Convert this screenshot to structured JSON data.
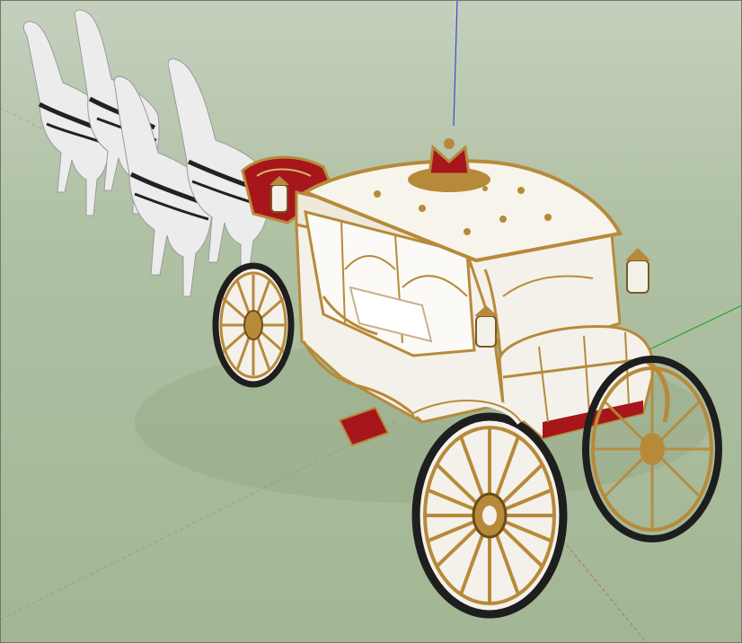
{
  "viewport": {
    "background_sky": "#c4d0bd",
    "background_ground": "#a6b898"
  },
  "axes": {
    "red_color": "#c0563a",
    "green_color": "#2aa52a",
    "blue_color": "#3a4ad0"
  },
  "model": {
    "body_color": "#f4f1ea",
    "gold_trim_color": "#b78a3a",
    "upholstery_color": "#a6161b",
    "tire_color": "#1e1e1e",
    "horse_color": "#e9e9ea",
    "harness_color": "#222222",
    "horses": [
      {
        "id": "horse-1"
      },
      {
        "id": "horse-2"
      },
      {
        "id": "horse-3"
      },
      {
        "id": "horse-4"
      }
    ],
    "wheels": [
      {
        "id": "rear-left"
      },
      {
        "id": "front-left"
      },
      {
        "id": "front-right"
      },
      {
        "id": "rear-right"
      }
    ],
    "lanterns": [
      {
        "id": "lantern-driver"
      },
      {
        "id": "lantern-corner-left"
      },
      {
        "id": "lantern-corner-right"
      }
    ]
  }
}
